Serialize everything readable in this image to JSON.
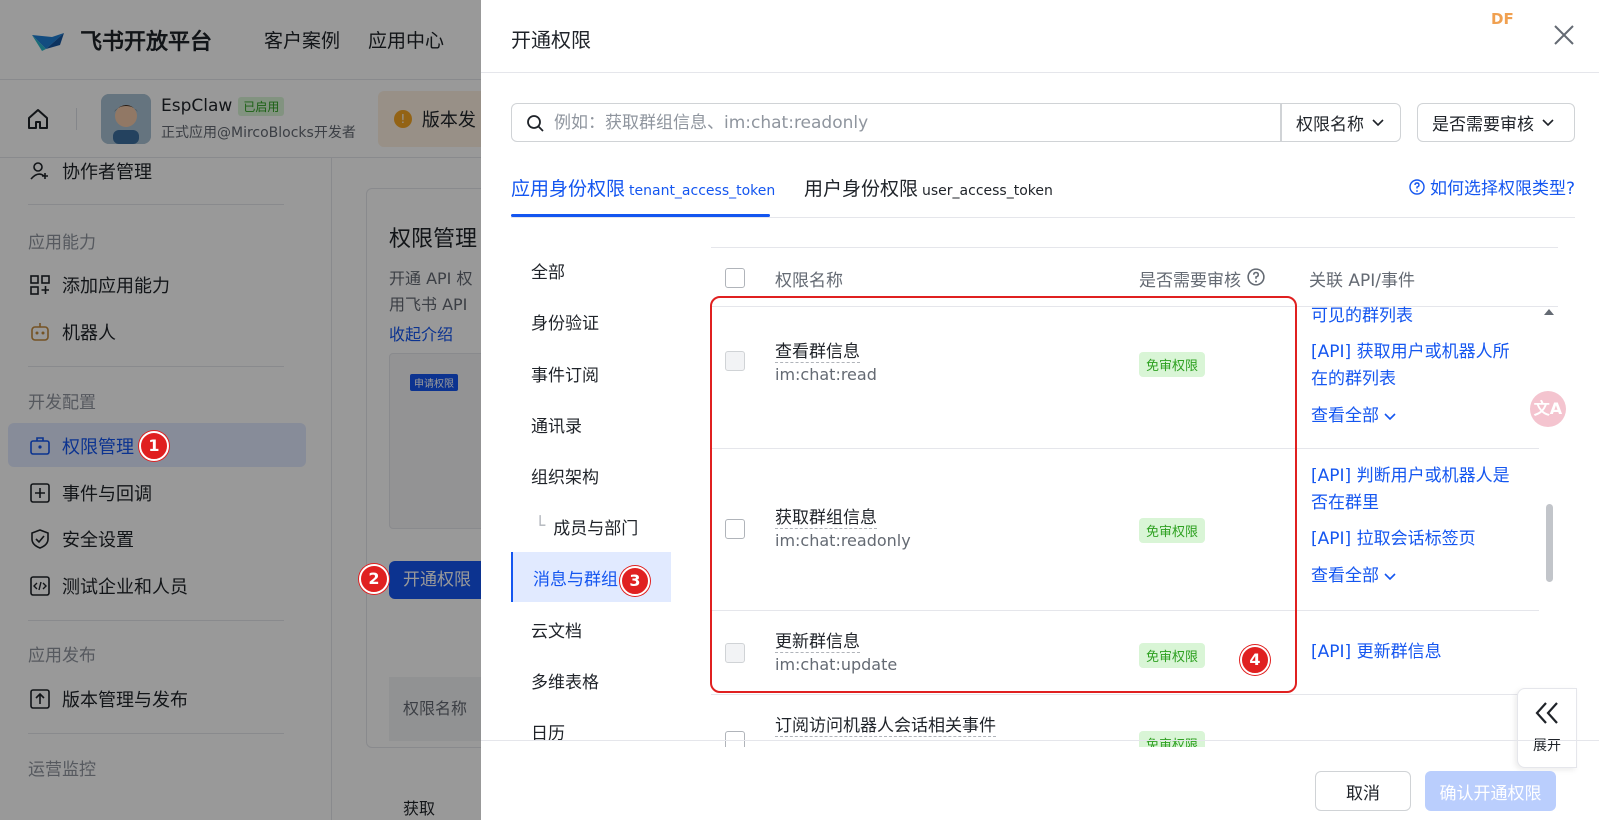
{
  "topbar": {
    "brand": "飞书开放平台",
    "nav": [
      "客户案例",
      "应用中心"
    ]
  },
  "app": {
    "name": "EspClaw",
    "status": "已启用",
    "subtitle": "正式应用@MircoBlocks开发者",
    "version_notice": "版本发"
  },
  "sidebar": {
    "items": [
      {
        "label": "协作者管理",
        "icon": "user-add-icon"
      },
      {
        "section": "应用能力"
      },
      {
        "label": "添加应用能力",
        "icon": "grid-add-icon"
      },
      {
        "label": "机器人",
        "icon": "robot-icon"
      },
      {
        "section": "开发配置"
      },
      {
        "label": "权限管理",
        "icon": "briefcase-icon",
        "active": true
      },
      {
        "label": "事件与回调",
        "icon": "event-icon"
      },
      {
        "label": "安全设置",
        "icon": "shield-icon"
      },
      {
        "label": "测试企业和人员",
        "icon": "code-icon"
      },
      {
        "section": "应用发布"
      },
      {
        "label": "版本管理与发布",
        "icon": "upload-icon"
      },
      {
        "section": "运营监控"
      }
    ]
  },
  "main": {
    "title": "权限管理",
    "desc1": "开通 API 权",
    "desc2": "用飞书 API",
    "collapse": "收起介绍",
    "apply_tag": "申请权限",
    "open_button": "开通权限",
    "col_label": "权限名称",
    "partial": "获取"
  },
  "badges": [
    "1",
    "2",
    "3",
    "4"
  ],
  "drawer": {
    "title": "开通权限",
    "corner_mark": "DF",
    "search_placeholder": "例如：获取群组信息、im:chat:readonly",
    "filter1": "权限名称",
    "filter2": "是否需要审核",
    "tabs": [
      {
        "label": "应用身份权限",
        "token": "tenant_access_token",
        "active": true
      },
      {
        "label": "用户身份权限",
        "token": "user_access_token"
      }
    ],
    "help": "如何选择权限类型?",
    "categories": [
      "全部",
      "身份验证",
      "事件订阅",
      "通讯录",
      "组织架构",
      "成员与部门",
      "消息与群组",
      "云文档",
      "多维表格",
      "日历"
    ],
    "columns": [
      "权限名称",
      "是否需要审核",
      "关联 API/事件"
    ],
    "rows": [
      {
        "name": "查看群信息",
        "code": "im:chat:read",
        "tag": "免审权限",
        "apis": [
          "可见的群列表",
          "[API] 获取用户或机器人所在的群列表"
        ],
        "more": "查看全部"
      },
      {
        "name": "获取群组信息",
        "code": "im:chat:readonly",
        "tag": "免审权限",
        "apis": [
          "[API] 判断用户或机器人是否在群里",
          "[API] 拉取会话标签页"
        ],
        "more": "查看全部"
      },
      {
        "name": "更新群信息",
        "code": "im:chat:update",
        "tag": "免审权限",
        "apis": [
          "[API] 更新群信息"
        ]
      },
      {
        "name": "订阅访问机器人会话相关事件",
        "code": "",
        "tag": "免审权限",
        "apis": []
      }
    ],
    "expand_label": "展开",
    "translate_glyph": "文A",
    "cancel": "取消",
    "confirm": "确认开通权限"
  }
}
